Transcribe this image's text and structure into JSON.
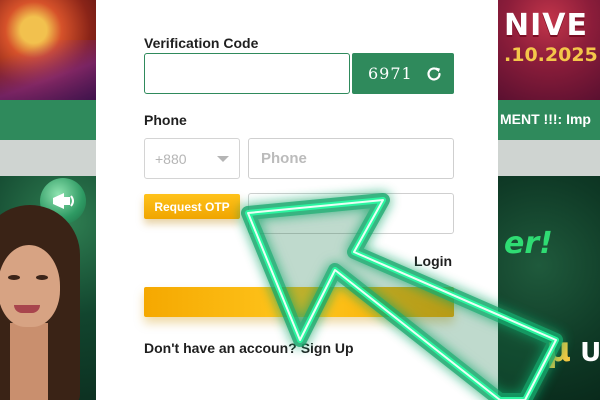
{
  "background": {
    "banner_title": "NIVE",
    "banner_date": ".10.2025",
    "marquee_text": "MENT !!!: Imp",
    "promo_title": "er!",
    "promo_sub_symbol": "µ",
    "promo_sub_text": "Up t"
  },
  "form": {
    "verification_label": "Verification Code",
    "verification_value": "",
    "captcha_text": "6971",
    "phone_label": "Phone",
    "country_code": "+880",
    "phone_placeholder": "Phone",
    "otp_button_label": "Request OTP",
    "otp_placeholder": "",
    "login_link": "Login",
    "submit_label": "",
    "signup_prompt": "Don't have an accoun",
    "signup_prompt_tail": "?",
    "signup_link": "Sign Up"
  },
  "colors": {
    "brand_green": "#2f8a5c",
    "accent_yellow": "#ffc21a",
    "arrow_neon": "#2cf5a0"
  },
  "icons": [
    "refresh-icon",
    "chevron-down-icon",
    "megaphone-icon",
    "arrow-pointer-icon"
  ]
}
